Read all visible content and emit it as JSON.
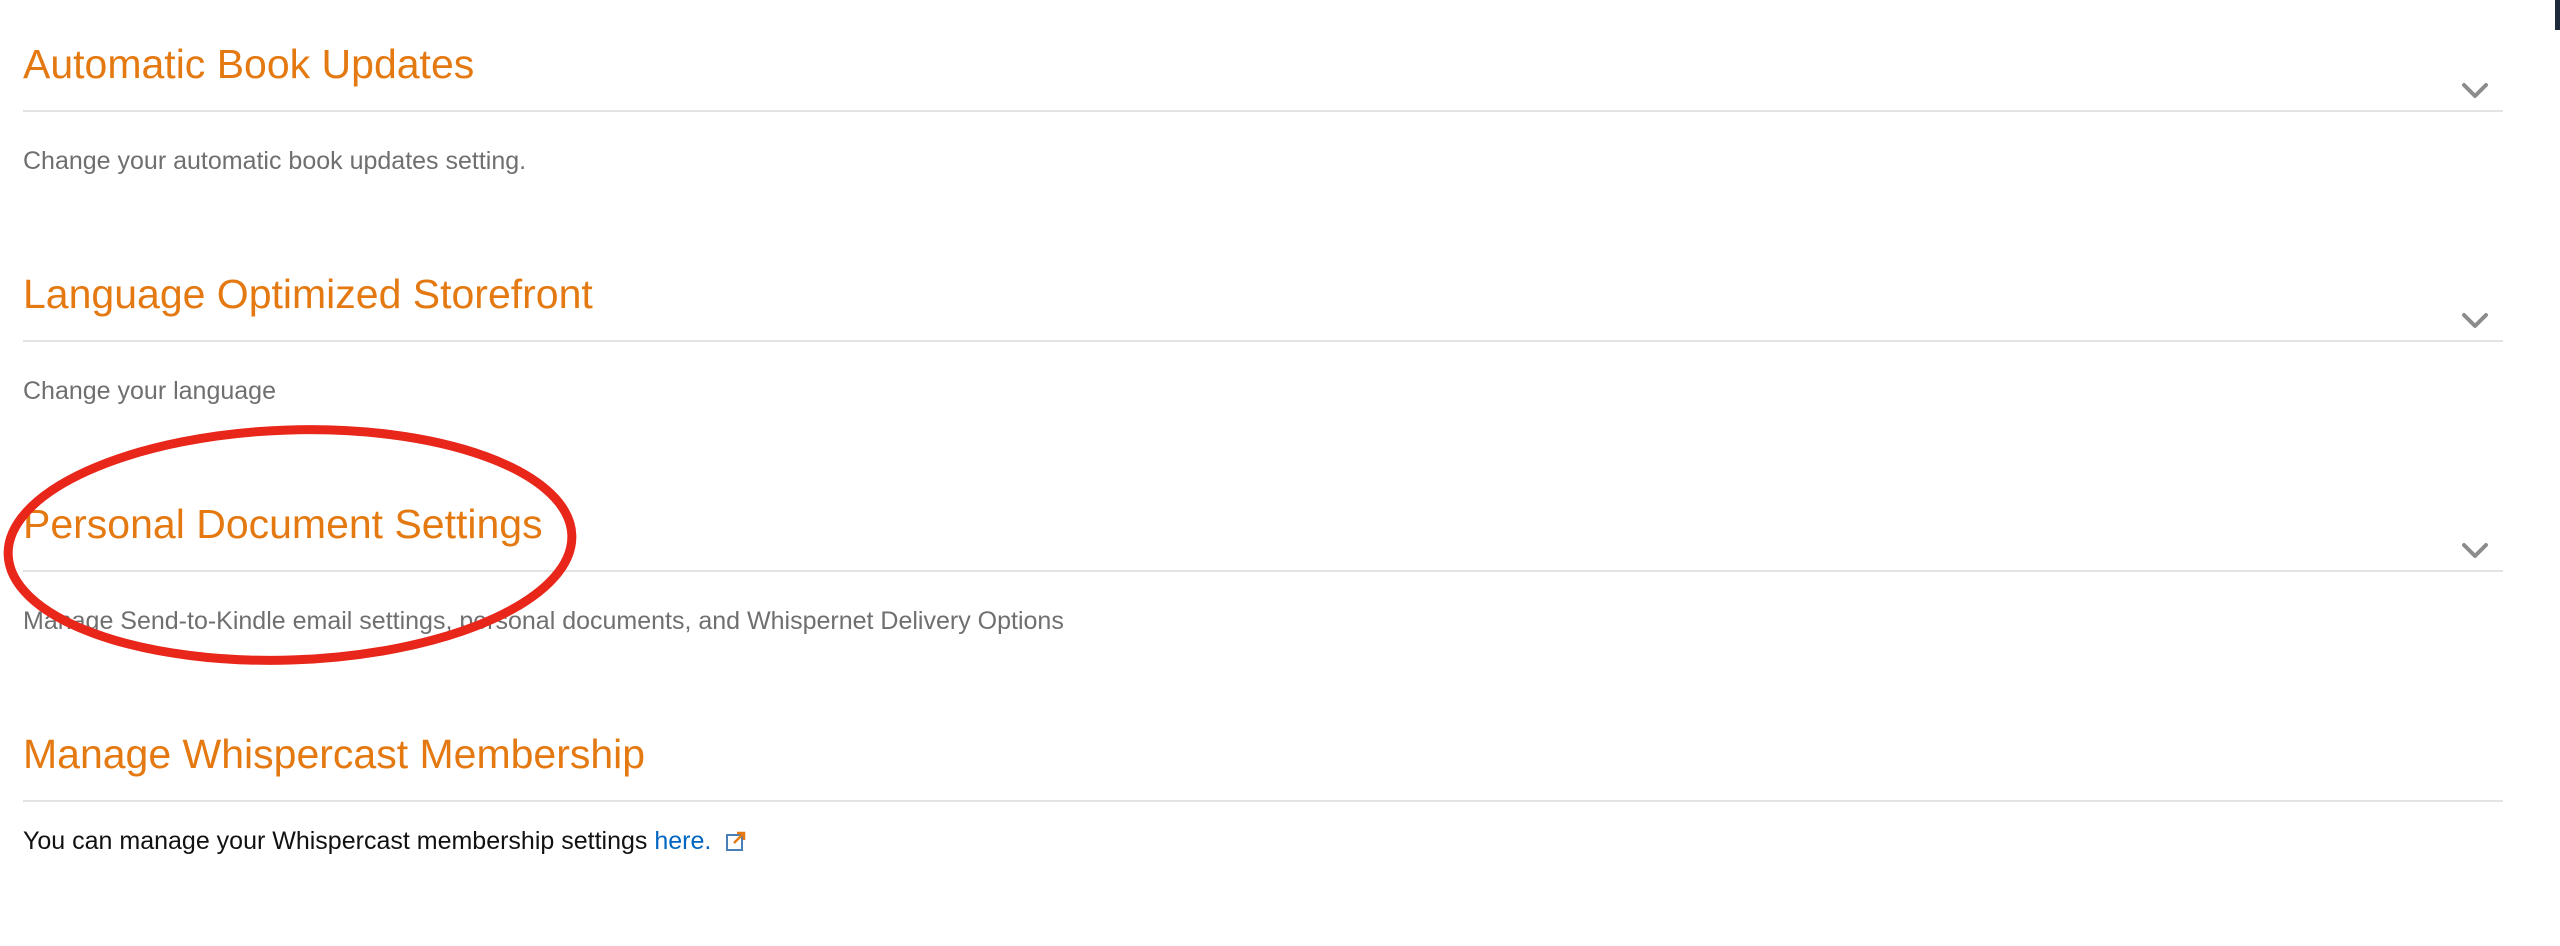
{
  "sections": [
    {
      "title": "Automatic Book Updates",
      "description": "Change your automatic book updates setting.",
      "expand_icon": "chevron-down-icon"
    },
    {
      "title": "Language Optimized Storefront",
      "description": "Change your language",
      "expand_icon": "chevron-down-icon"
    },
    {
      "title": "Personal Document Settings",
      "description": "Manage Send-to-Kindle email settings, personal documents, and Whispernet Delivery Options",
      "expand_icon": "chevron-down-icon"
    },
    {
      "title": "Manage Whispercast Membership",
      "description_prefix": "You can manage your Whispercast membership settings",
      "link_text": "here.",
      "link_icon": "external-link-icon"
    }
  ],
  "colors": {
    "title": "#e47911",
    "link": "#0066c0",
    "annotation": "#e8261a"
  },
  "annotation": {
    "shape": "ellipse",
    "highlights": "Personal Document Settings"
  }
}
